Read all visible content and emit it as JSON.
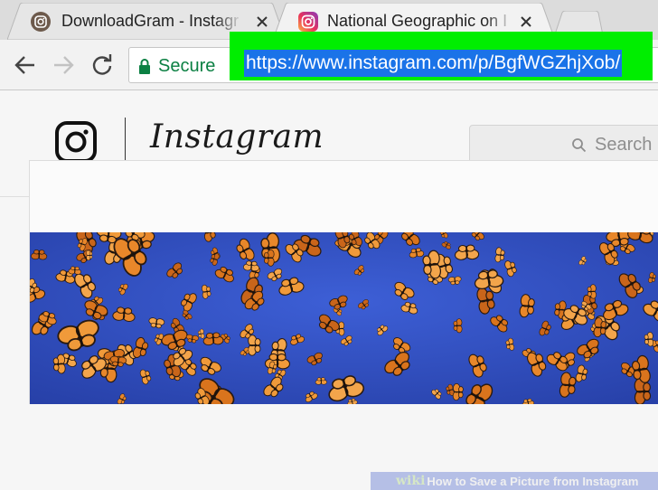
{
  "browser": {
    "tabs": [
      {
        "title": "DownloadGram - Instagr",
        "active": false
      },
      {
        "title": "National Geographic on I",
        "active": true
      }
    ],
    "omnibox": {
      "security_label": "Secure",
      "url": "https://www.instagram.com/p/BgfWGZhjXob/"
    },
    "highlight_color": "#00ee00"
  },
  "instagram": {
    "wordmark": "Instagram",
    "search_placeholder": "Search"
  },
  "watermark": {
    "brand": "wiki",
    "title": "How to Save a Picture from Instagram"
  }
}
